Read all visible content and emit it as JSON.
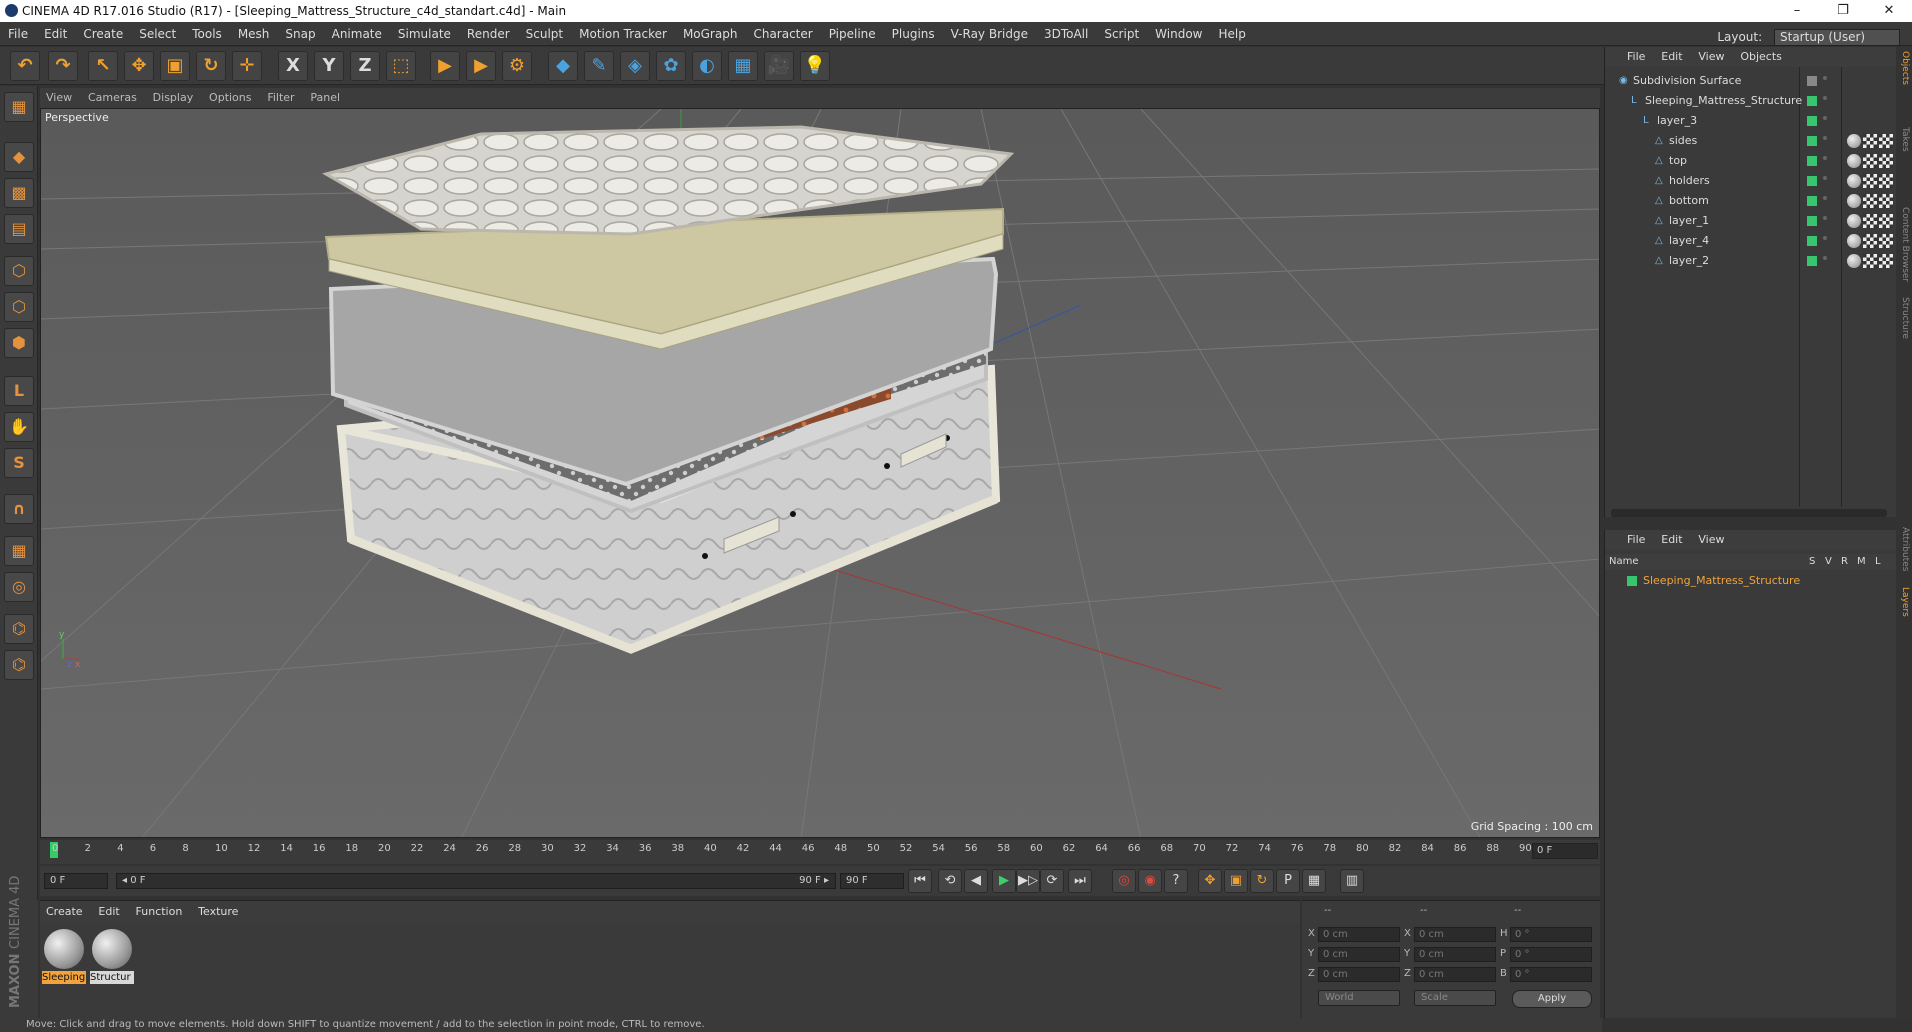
{
  "window": {
    "title": "CINEMA 4D R17.016 Studio (R17) - [Sleeping_Mattress_Structure_c4d_standart.c4d] - Main",
    "controls": [
      "–",
      "❐",
      "✕"
    ]
  },
  "menubar": {
    "items": [
      "File",
      "Edit",
      "Create",
      "Select",
      "Tools",
      "Mesh",
      "Snap",
      "Animate",
      "Simulate",
      "Render",
      "Sculpt",
      "Motion Tracker",
      "MoGraph",
      "Character",
      "Pipeline",
      "Plugins",
      "V-Ray Bridge",
      "3DToAll",
      "Script",
      "Window",
      "Help"
    ],
    "layout_label": "Layout:",
    "layout_value": "Startup (User)"
  },
  "toolbar": {
    "buttons": [
      {
        "name": "undo",
        "glyph": "↶"
      },
      {
        "name": "redo",
        "glyph": "↷"
      },
      {
        "name": "live-selection",
        "glyph": "↖"
      },
      {
        "name": "move",
        "glyph": "✥"
      },
      {
        "name": "scale",
        "glyph": "▣"
      },
      {
        "name": "rotate",
        "glyph": "↻"
      },
      {
        "name": "recent-tool",
        "glyph": "✛"
      },
      {
        "name": "x-axis",
        "glyph": "X"
      },
      {
        "name": "y-axis",
        "glyph": "Y"
      },
      {
        "name": "z-axis",
        "glyph": "Z"
      },
      {
        "name": "coordinate-system",
        "glyph": "⬚"
      },
      {
        "name": "render-view",
        "glyph": "▶"
      },
      {
        "name": "render-picture-viewer",
        "glyph": "▶"
      },
      {
        "name": "edit-render-settings",
        "glyph": "⚙"
      },
      {
        "name": "cube",
        "glyph": "◆"
      },
      {
        "name": "pen",
        "glyph": "✎"
      },
      {
        "name": "subdivision",
        "glyph": "◈"
      },
      {
        "name": "array",
        "glyph": "✿"
      },
      {
        "name": "deformer",
        "glyph": "◐"
      },
      {
        "name": "floor",
        "glyph": "▦"
      },
      {
        "name": "camera",
        "glyph": "🎥"
      },
      {
        "name": "light",
        "glyph": "💡"
      }
    ]
  },
  "left_tools": [
    {
      "name": "make-editable",
      "glyph": "▦"
    },
    {
      "name": "model-mode",
      "glyph": "◆"
    },
    {
      "name": "texture-mode",
      "glyph": "▩"
    },
    {
      "name": "workplane",
      "glyph": "▤"
    },
    {
      "name": "points-mode",
      "glyph": "⬡"
    },
    {
      "name": "edges-mode",
      "glyph": "⬡"
    },
    {
      "name": "polygons-mode",
      "glyph": "⬢"
    },
    {
      "name": "axis-mode",
      "glyph": "L"
    },
    {
      "name": "tweak-mode",
      "glyph": "✋"
    },
    {
      "name": "snap",
      "glyph": "S"
    },
    {
      "name": "magnet",
      "glyph": "∩"
    },
    {
      "name": "workplane-lock",
      "glyph": "▦"
    },
    {
      "name": "solo",
      "glyph": "◎"
    },
    {
      "name": "python-1",
      "glyph": "⌬"
    },
    {
      "name": "python-2",
      "glyph": "⌬"
    }
  ],
  "viewport": {
    "menu": [
      "View",
      "Cameras",
      "Display",
      "Options",
      "Filter",
      "Panel"
    ],
    "label": "Perspective",
    "grid_spacing": "Grid Spacing : 100 cm"
  },
  "timeline": {
    "ticks": [
      "0",
      "2",
      "4",
      "6",
      "8",
      "10",
      "12",
      "14",
      "16",
      "18",
      "20",
      "22",
      "24",
      "26",
      "28",
      "30",
      "32",
      "34",
      "36",
      "38",
      "40",
      "42",
      "44",
      "46",
      "48",
      "50",
      "52",
      "54",
      "56",
      "58",
      "60",
      "62",
      "64",
      "66",
      "68",
      "70",
      "72",
      "74",
      "76",
      "78",
      "80",
      "82",
      "84",
      "86",
      "88",
      "90"
    ],
    "current_frame": "0 F"
  },
  "transport": {
    "start_field": "0 F",
    "range_left": "◂ 0 F",
    "range_right": "90 F ▸",
    "end_field": "90 F",
    "buttons": [
      "⏮",
      "⟲",
      "◀",
      "▶",
      "▶▷",
      "⟳",
      "⏭",
      "◎",
      "◉",
      "?",
      "✥",
      "▣",
      "↻",
      "P",
      "▦",
      "▥"
    ]
  },
  "material_manager": {
    "menu": [
      "Create",
      "Edit",
      "Function",
      "Texture"
    ],
    "materials": [
      {
        "name": "Sleeping",
        "selected": true
      },
      {
        "name": "Structur",
        "selected": false
      }
    ],
    "brand_line1": "MAXON",
    "brand_line2": "CINEMA 4D"
  },
  "coordinates": {
    "header": [
      "--",
      "--",
      "--"
    ],
    "rows": [
      {
        "a": "X",
        "av": "0 cm",
        "b": "X",
        "bv": "0 cm",
        "c": "H",
        "cv": "0 °"
      },
      {
        "a": "Y",
        "av": "0 cm",
        "b": "Y",
        "bv": "0 cm",
        "c": "P",
        "cv": "0 °"
      },
      {
        "a": "Z",
        "av": "0 cm",
        "b": "Z",
        "bv": "0 cm",
        "c": "B",
        "cv": "0 °"
      }
    ],
    "mode1": "World",
    "mode2": "Scale",
    "apply": "Apply"
  },
  "status": "Move: Click and drag to move elements. Hold down SHIFT to quantize movement / add to the selection in point mode, CTRL to remove.",
  "object_manager": {
    "menu": [
      "File",
      "Edit",
      "View",
      "Objects"
    ],
    "objects": [
      {
        "label": "Subdivision Surface",
        "depth": 0,
        "tags": 0
      },
      {
        "label": "Sleeping_Mattress_Structure",
        "depth": 1,
        "tags": 0
      },
      {
        "label": "layer_3",
        "depth": 2,
        "tags": 0
      },
      {
        "label": "sides",
        "depth": 3,
        "tags": 3
      },
      {
        "label": "top",
        "depth": 3,
        "tags": 3
      },
      {
        "label": "holders",
        "depth": 3,
        "tags": 3
      },
      {
        "label": "bottom",
        "depth": 3,
        "tags": 3
      },
      {
        "label": "layer_1",
        "depth": 3,
        "tags": 3
      },
      {
        "label": "layer_4",
        "depth": 3,
        "tags": 3
      },
      {
        "label": "layer_2",
        "depth": 3,
        "tags": 3
      }
    ]
  },
  "layer_manager": {
    "menu": [
      "File",
      "Edit",
      "View"
    ],
    "columns": [
      "Name",
      "S",
      "V",
      "R",
      "M",
      "L"
    ],
    "layer": "Sleeping_Mattress_Structure"
  },
  "side_tabs": [
    "Objects",
    "Takes",
    "Content Browser",
    "Structure",
    "Attributes",
    "Layers"
  ]
}
